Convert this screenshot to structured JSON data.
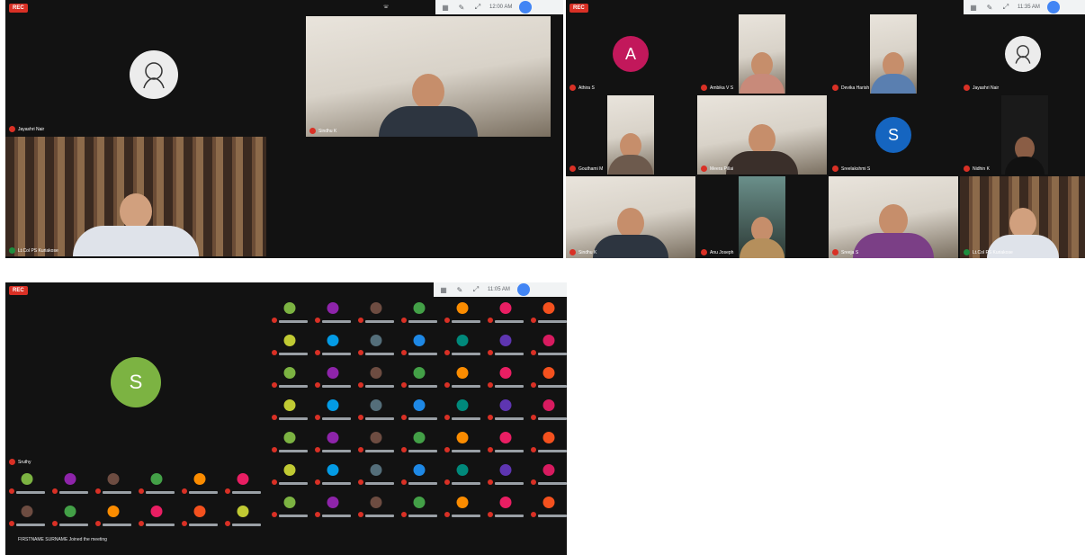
{
  "screens": {
    "s1": {
      "rec": "REC",
      "topbar_time": "12:00 AM",
      "tiles": [
        {
          "name": "Jayashri Nair",
          "kind": "avatar-img"
        },
        {
          "name": "Sindhu K",
          "kind": "video"
        },
        {
          "name": "Lt.Col PS Kuriakose",
          "kind": "video"
        },
        {
          "name": "",
          "kind": "empty"
        }
      ]
    },
    "s2": {
      "rec": "REC",
      "topbar_time": "11:35 AM",
      "tiles": [
        {
          "name": "Athira S",
          "letter": "A",
          "color": "#c2185b"
        },
        {
          "name": "Ambika V S",
          "kind": "video"
        },
        {
          "name": "Devika Harish",
          "kind": "video"
        },
        {
          "name": "Jayashri Nair",
          "kind": "avatar-img"
        },
        {
          "name": "Gouthami M",
          "kind": "video"
        },
        {
          "name": "Meera Pillai",
          "kind": "video"
        },
        {
          "name": "Sreelakshmi S",
          "letter": "S",
          "color": "#1565c0"
        },
        {
          "name": "Nidhin K",
          "kind": "video"
        },
        {
          "name": "Sindhu K",
          "kind": "video"
        },
        {
          "name": "Anu Joseph",
          "kind": "video"
        },
        {
          "name": "Sreeja S",
          "kind": "video"
        },
        {
          "name": "Lt.Col PS Kuriakose",
          "kind": "video"
        }
      ]
    },
    "s3": {
      "rec": "REC",
      "topbar_time": "11:05 AM",
      "main": {
        "letter": "S",
        "color": "#7cb342",
        "name": "Sruthy"
      },
      "footer_text": "FIRSTNAME SURNAME Joined the meeting"
    }
  },
  "colors": {
    "grid": [
      "#7cb342",
      "#e91e63",
      "#1e88e5",
      "#8e24aa",
      "#f4511e",
      "#00897b",
      "#6d4c41",
      "#c0ca33",
      "#5e35b1",
      "#43a047",
      "#039be5",
      "#d81b60",
      "#fb8c00",
      "#546e7a"
    ]
  }
}
